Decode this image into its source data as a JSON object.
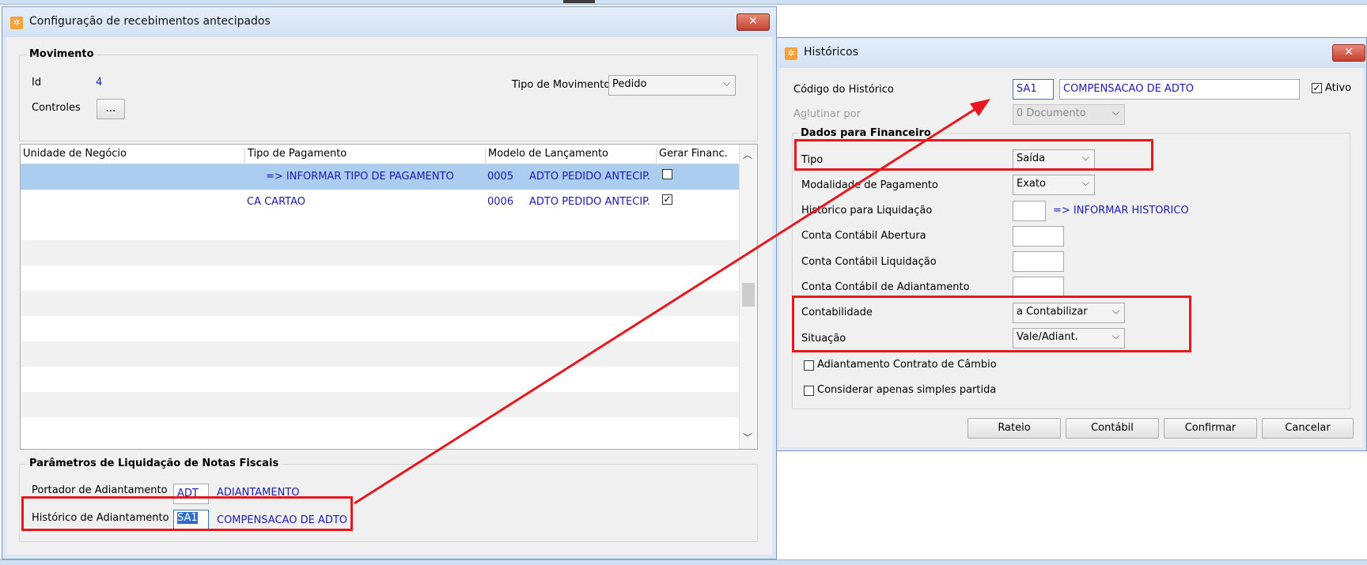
{
  "left_window": {
    "title": "Configuração de recebimentos antecipados",
    "close": "✕",
    "movimento": {
      "group_title": "Movimento",
      "id_label": "Id",
      "id_value": "4",
      "controles_label": "Controles",
      "controles_button": "...",
      "tipo_label": "Tipo de Movimento",
      "tipo_value": "Pedido"
    },
    "grid": {
      "headers": [
        "Unidade de Negócio",
        "Tipo de Pagamento",
        "Modelo de Lançamento",
        "Gerar Financ."
      ],
      "rows": [
        {
          "unidade": "",
          "tipo": "=> INFORMAR TIPO DE PAGAMENTO",
          "modelo_code": "0005",
          "modelo_desc": "ADTO PEDIDO ANTECIP.",
          "gerar": false
        },
        {
          "unidade": "",
          "tipo": "CA  CARTAO",
          "modelo_code": "0006",
          "modelo_desc": "ADTO PEDIDO ANTECIP.",
          "gerar": true
        }
      ]
    },
    "parametros": {
      "group_title": "Parâmetros de Liquidação de Notas Fiscais",
      "portador_label": "Portador de Adiantamento",
      "portador_code": "ADT",
      "portador_desc": "ADIANTAMENTO",
      "historico_label": "Histórico de Adiantamento",
      "historico_code": "SA1",
      "historico_desc": "COMPENSACAO DE ADTO"
    }
  },
  "right_window": {
    "title": "Históricos",
    "close": "✕",
    "codigo_label": "Código do Histórico",
    "codigo_value": "SA1",
    "codigo_desc": "COMPENSACAO DE ADTO",
    "ativo_label": "Ativo",
    "aglutinar_label": "Aglutinar por",
    "aglutinar_value": "0 Documento",
    "dados_title": "Dados para Financeiro",
    "tipo_label": "Tipo",
    "tipo_value": "Saída",
    "modalidade_label": "Modalidade de Pagamento",
    "modalidade_value": "Exato",
    "hist_liq_label": "Histórico para Liquidação",
    "hist_liq_desc": "=> INFORMAR HISTORICO",
    "conta_abertura_label": "Conta Contábil Abertura",
    "conta_liquidacao_label": "Conta Contábil Liquidação",
    "conta_adiantamento_label": "Conta Contábil de Adiantamento",
    "contabilidade_label": "Contabilidade",
    "contabilidade_value": "a Contabilizar",
    "situacao_label": "Situação",
    "situacao_value": "Vale/Adiant.",
    "cambio_label": "Adiantamento Contrato de Câmbio",
    "simples_label": "Considerar apenas simples partida",
    "buttons": {
      "rateio": "Rateio",
      "contabil": "Contábil",
      "confirmar": "Confirmar",
      "cancelar": "Cancelar"
    }
  },
  "colors": {
    "highlight_box": "#e8171d",
    "arrow": "#e8171d",
    "selected_row": "#aacdf0",
    "link_text": "#1a1ab8"
  }
}
